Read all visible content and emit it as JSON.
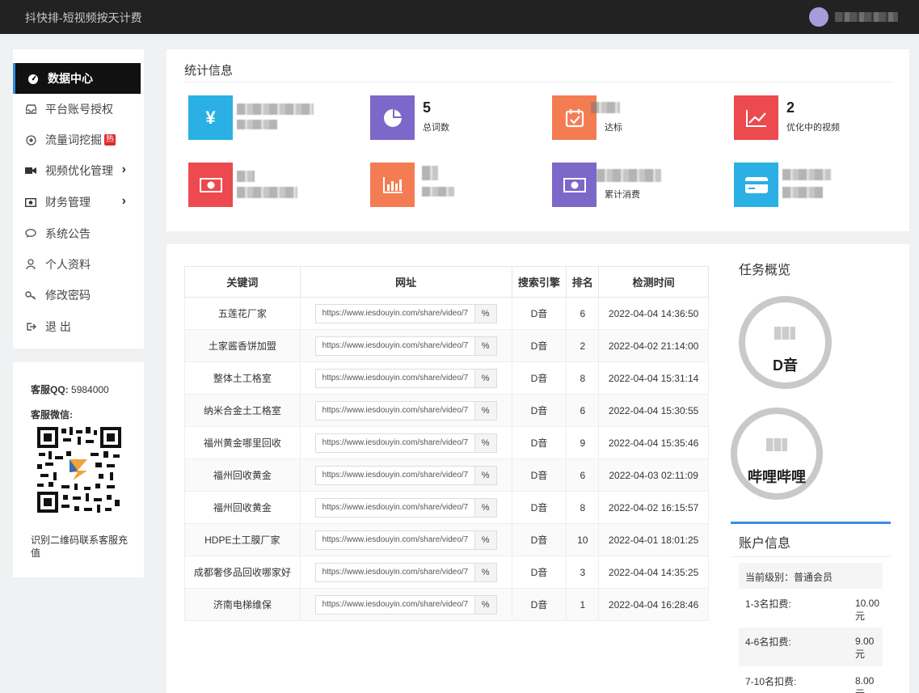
{
  "topbar": {
    "title": "抖快排-短视频按天计费"
  },
  "sidebar": {
    "items": [
      {
        "label": "数据中心",
        "icon": "dashboard-icon"
      },
      {
        "label": "平台账号授权",
        "icon": "inbox-icon"
      },
      {
        "label": "流量词挖掘",
        "icon": "target-icon",
        "badge": "热"
      },
      {
        "label": "视频优化管理",
        "icon": "video-icon"
      },
      {
        "label": "财务管理",
        "icon": "money-icon"
      },
      {
        "label": "系统公告",
        "icon": "chat-icon"
      },
      {
        "label": "个人资料",
        "icon": "user-icon"
      },
      {
        "label": "修改密码",
        "icon": "key-icon"
      },
      {
        "label": "退 出",
        "icon": "logout-icon"
      }
    ]
  },
  "service": {
    "qq_label": "客服QQ:",
    "qq_value": "5984000",
    "wechat_label": "客服微信:",
    "note": "识别二维码联系客服充值"
  },
  "stats": {
    "title": "统计信息",
    "items": [
      {
        "icon": "yen-icon",
        "color": "#2ab0e4",
        "value": "",
        "label": ""
      },
      {
        "icon": "pie-icon",
        "color": "#7b68c8",
        "value": "5",
        "label": "总词数"
      },
      {
        "icon": "calendar-check-icon",
        "color": "#f47c53",
        "value": "",
        "label": "达标"
      },
      {
        "icon": "trend-icon",
        "color": "#ec4a4e",
        "value": "2",
        "label": "优化中的视频"
      },
      {
        "icon": "cash-icon",
        "color": "#ec4a4e",
        "value": "",
        "label": ""
      },
      {
        "icon": "bar-chart-icon",
        "color": "#f47c53",
        "value": "",
        "label": ""
      },
      {
        "icon": "cash-icon",
        "color": "#7b68c8",
        "value": "",
        "label": "累计消费"
      },
      {
        "icon": "card-icon",
        "color": "#2ab0e4",
        "value": "",
        "label": ""
      }
    ]
  },
  "table": {
    "headers": [
      "关键词",
      "网址",
      "搜索引擎",
      "排名",
      "检测时间"
    ],
    "rows": [
      {
        "keyword": "五莲花厂家",
        "url": "https://www.iesdouyin.com/share/video/7",
        "engine": "D音",
        "rank": "6",
        "time": "2022-04-04 14:36:50"
      },
      {
        "keyword": "土家酱香饼加盟",
        "url": "https://www.iesdouyin.com/share/video/7",
        "engine": "D音",
        "rank": "2",
        "time": "2022-04-02 21:14:00"
      },
      {
        "keyword": "整体土工格室",
        "url": "https://www.iesdouyin.com/share/video/7",
        "engine": "D音",
        "rank": "8",
        "time": "2022-04-04 15:31:14"
      },
      {
        "keyword": "纳米合金土工格室",
        "url": "https://www.iesdouyin.com/share/video/7",
        "engine": "D音",
        "rank": "6",
        "time": "2022-04-04 15:30:55"
      },
      {
        "keyword": "福州黄金哪里回收",
        "url": "https://www.iesdouyin.com/share/video/7",
        "engine": "D音",
        "rank": "9",
        "time": "2022-04-04 15:35:46"
      },
      {
        "keyword": "福州回收黄金",
        "url": "https://www.iesdouyin.com/share/video/7",
        "engine": "D音",
        "rank": "6",
        "time": "2022-04-03 02:11:09"
      },
      {
        "keyword": "福州回收黄金",
        "url": "https://www.iesdouyin.com/share/video/7",
        "engine": "D音",
        "rank": "8",
        "time": "2022-04-02 16:15:57"
      },
      {
        "keyword": "HDPE土工膜厂家",
        "url": "https://www.iesdouyin.com/share/video/7",
        "engine": "D音",
        "rank": "10",
        "time": "2022-04-01 18:01:25"
      },
      {
        "keyword": "成都奢侈品回收哪家好",
        "url": "https://www.iesdouyin.com/share/video/7",
        "engine": "D音",
        "rank": "3",
        "time": "2022-04-04 14:35:25"
      },
      {
        "keyword": "济南电梯维保",
        "url": "https://www.iesdouyin.com/share/video/7",
        "engine": "D音",
        "rank": "1",
        "time": "2022-04-04 16:28:46"
      }
    ]
  },
  "task": {
    "title": "任务概览",
    "rings": [
      {
        "label": "D音"
      },
      {
        "label": "哔哩哔哩"
      }
    ]
  },
  "account": {
    "title": "账户信息",
    "level": "当前级别：普通会员",
    "fees": [
      {
        "label": "1-3名扣费:",
        "value": "10.00元"
      },
      {
        "label": "4-6名扣费:",
        "value": "9.00元"
      },
      {
        "label": "7-10名扣费:",
        "value": "8.00元"
      }
    ]
  }
}
